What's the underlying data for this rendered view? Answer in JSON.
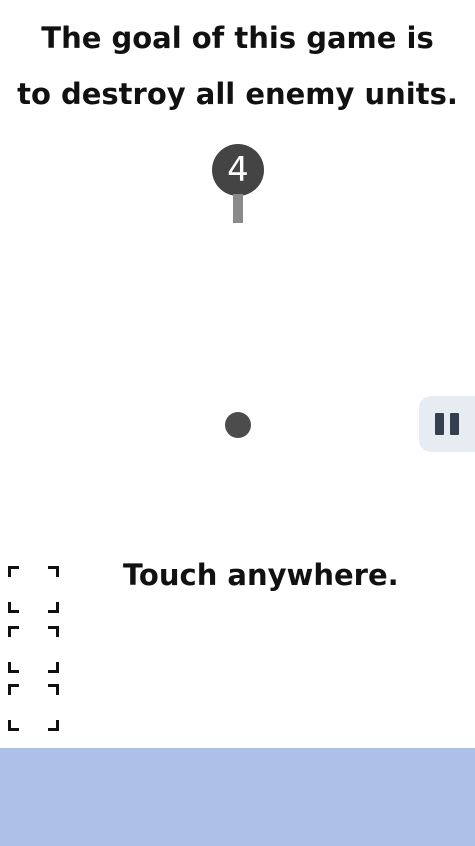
{
  "instructions": {
    "line1": "The goal of this game is",
    "line2": "to destroy all enemy units."
  },
  "enemy": {
    "hp": "4"
  },
  "hint": "Touch anywhere.",
  "colors": {
    "enemy": "#444444",
    "player": "#4c4c4c",
    "pause_bg": "#e7ebf2",
    "bottom_panel": "#adc1e8"
  },
  "icons": {
    "pause": "pause-icon"
  }
}
